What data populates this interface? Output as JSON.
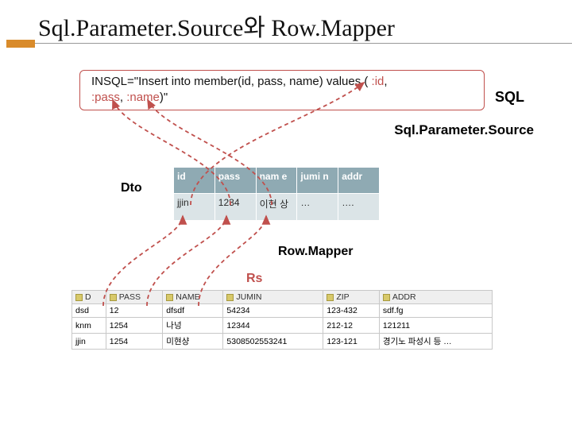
{
  "title": "Sql.Parameter.Source와 Row.Mapper",
  "sql_box": {
    "line1_prefix": "INSQL=\"Insert into member(id, pass, name) values ( ",
    "p_id": ":id",
    "sep1": ", ",
    "p_pass": ":pass",
    "sep2": ", ",
    "p_name": ":name",
    "line1_suffix": ")\""
  },
  "labels": {
    "sql": "SQL",
    "sps": "Sql.Parameter.Source",
    "dto": "Dto",
    "rowmapper": "Row.Mapper",
    "rs": "Rs"
  },
  "dto_table": {
    "headers": [
      "id",
      "pass",
      "nam e",
      "jumi n",
      "addr"
    ],
    "row": [
      "jjin",
      "1234",
      "이현 상",
      "…",
      "…."
    ]
  },
  "db_grid": {
    "headers": [
      "D",
      "PASS",
      "NAME",
      "JUMIN",
      "ZIP",
      "ADDR"
    ],
    "rows": [
      [
        "dsd",
        "12",
        "dfsdf",
        "54234",
        "123-432",
        "sdf.fg"
      ],
      [
        "knm",
        "1254",
        "나넝",
        "12344",
        "212-12",
        "121211"
      ],
      [
        "jjin",
        "1254",
        "미현샹",
        "5308502553241",
        "123-121",
        "경기노 파성시 등 …"
      ]
    ]
  }
}
